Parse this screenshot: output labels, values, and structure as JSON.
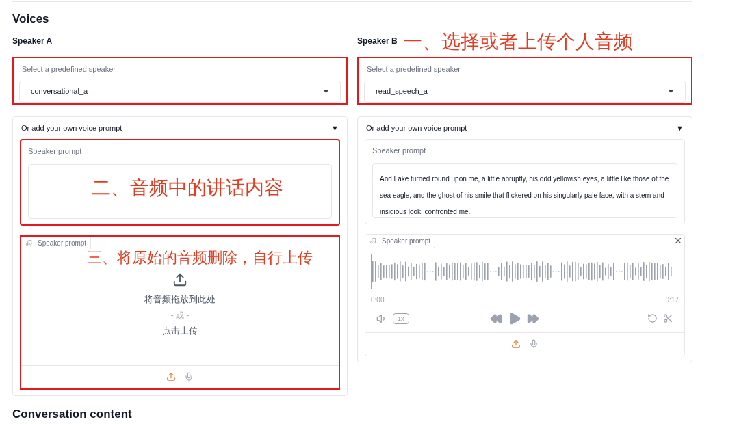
{
  "heading": "Voices",
  "speakers": [
    {
      "label": "Speaker A",
      "select": {
        "label": "Select a predefined speaker",
        "value": "conversational_a",
        "highlighted": true
      },
      "prompt": {
        "title": "Or add your own voice prompt",
        "toggle": "▼",
        "expanded": true,
        "text": {
          "label": "Speaker prompt",
          "highlighted": true,
          "annotation": "二、音频中的讲话内容"
        },
        "audio": {
          "kind": "empty",
          "label": "Speaker prompt",
          "highlighted": true,
          "annotation": "三、将原始的音频删除，自行上传",
          "drop_text": "将音频拖放到此处",
          "or_text": "- 或 -",
          "click_text": "点击上传"
        }
      }
    },
    {
      "label": "Speaker B",
      "annotation": "一、选择或者上传个人音频",
      "select": {
        "label": "Select a predefined speaker",
        "value": "read_speech_a",
        "highlighted": true
      },
      "prompt": {
        "title": "Or add your own voice prompt",
        "toggle": "▼",
        "expanded": true,
        "text": {
          "label": "Speaker prompt",
          "value": "And Lake turned round upon me, a little abruptly, his odd yellowish eyes, a little like those of the sea eagle, and the ghost of his smile that flickered on his singularly pale face, with a stern and insidious look, confronted me.",
          "highlighted": false
        },
        "audio": {
          "kind": "loaded",
          "label": "Speaker prompt",
          "highlighted": false,
          "start": "0:00",
          "end": "0:17",
          "speed": "1x"
        }
      }
    }
  ],
  "footer_heading": "Conversation content"
}
